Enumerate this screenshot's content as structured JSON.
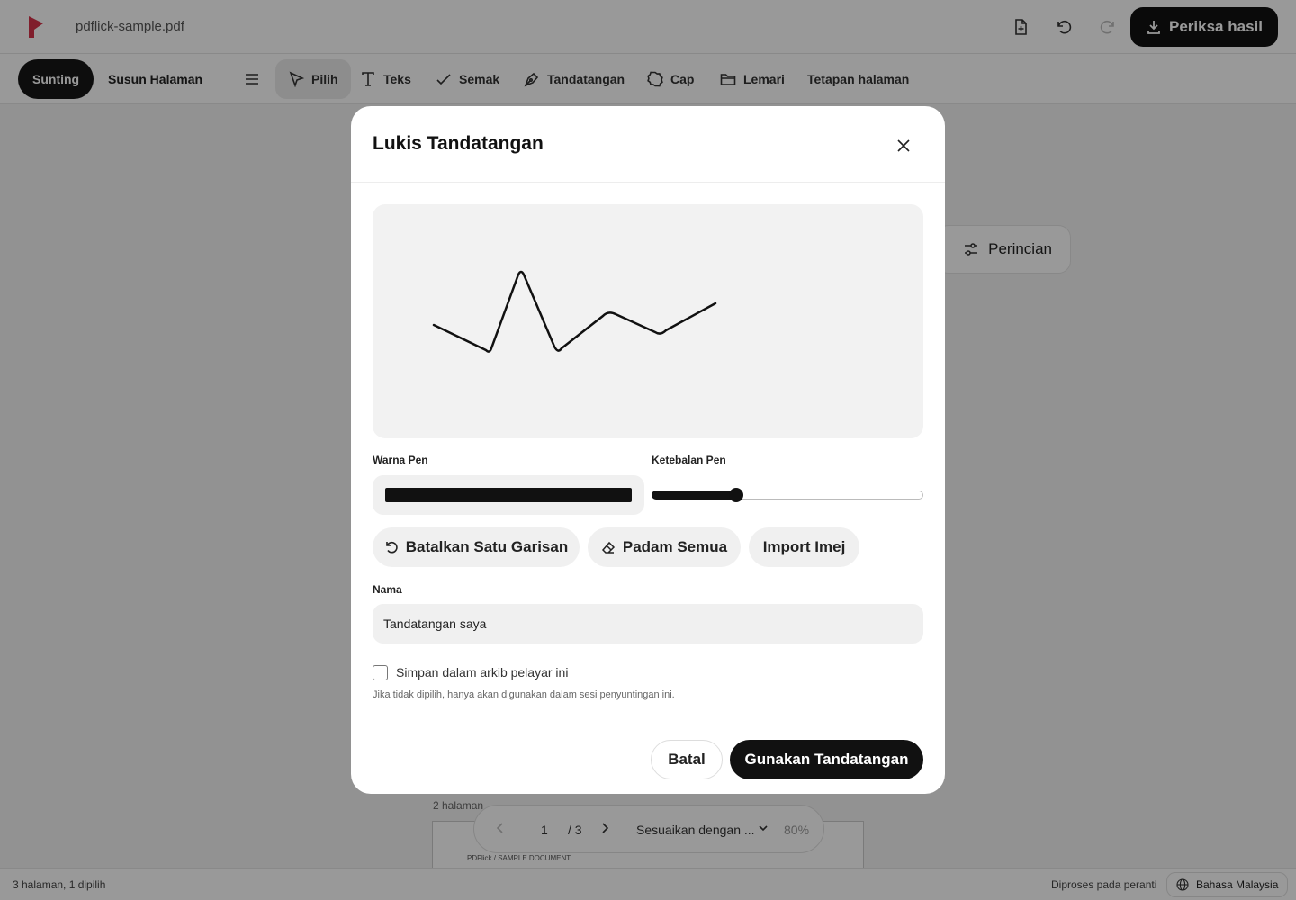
{
  "app": {
    "filename": "pdflick-sample.pdf",
    "primary_action": "Periksa hasil"
  },
  "toolbar": {
    "modes": [
      "Sunting",
      "Susun Halaman"
    ],
    "tools": [
      "Pilih",
      "Teks",
      "Semak",
      "Tandatangan",
      "Cap",
      "Lemari",
      "Tetapan halaman"
    ]
  },
  "canvas": {
    "details_label": "Perincian",
    "pages_label": "2 halaman",
    "page_header": "PDFlick / SAMPLE DOCUMENT"
  },
  "pager": {
    "current_page": "1",
    "total": "/ 3",
    "fit_mode": "Sesuaikan dengan ...",
    "zoom": "80%"
  },
  "status": {
    "left": "3 halaman, 1 dipilih",
    "processing": "Diproses pada peranti",
    "language": "Bahasa Malaysia"
  },
  "modal": {
    "title": "Lukis Tandatangan",
    "pen_color_label": "Warna Pen",
    "pen_color": "#111111",
    "pen_width_label": "Ketebalan Pen",
    "pen_width_fraction": 0.31,
    "undo_label": "Batalkan Satu Garisan",
    "clear_label": "Padam Semua",
    "import_label": "Import Imej",
    "name_label": "Nama",
    "name_value": "Tandatangan saya",
    "save_label": "Simpan dalam arkib pelayar ini",
    "hint": "Jika tidak dipilih, hanya akan digunakan dalam sesi penyuntingan ini.",
    "cancel_label": "Batal",
    "use_label": "Gunakan Tandatangan"
  },
  "colors": {
    "brand": "#d6334a",
    "primary": "#111111"
  }
}
